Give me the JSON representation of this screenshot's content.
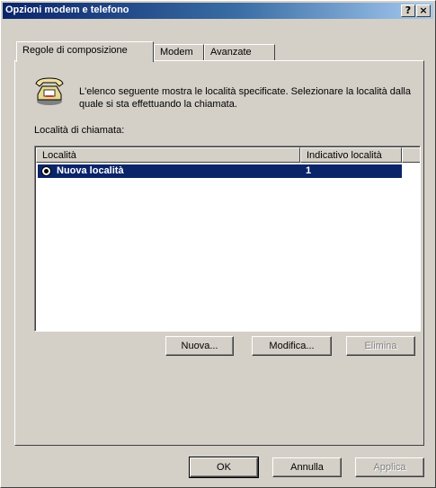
{
  "window": {
    "title": "Opzioni modem e telefono",
    "help_button": "?",
    "close_button": "×"
  },
  "tabs": [
    {
      "label": "Regole di composizione",
      "active": true
    },
    {
      "label": "Modem",
      "active": false
    },
    {
      "label": "Avanzate",
      "active": false
    }
  ],
  "panel": {
    "description": "L'elenco seguente mostra le località specificate. Selezionare la località dalla quale si sta effettuando la chiamata.",
    "locations_label": "Località di chiamata:",
    "columns": [
      "Località",
      "Indicativo località"
    ],
    "rows": [
      {
        "name": "Nuova località",
        "area_code": "1",
        "selected": true
      }
    ],
    "buttons": {
      "new": "Nuova...",
      "edit": "Modifica...",
      "delete": "Elimina"
    }
  },
  "footer": {
    "ok": "OK",
    "cancel": "Annulla",
    "apply": "Applica"
  },
  "colors": {
    "selection": "#0a246a",
    "face": "#d4d0c8"
  }
}
